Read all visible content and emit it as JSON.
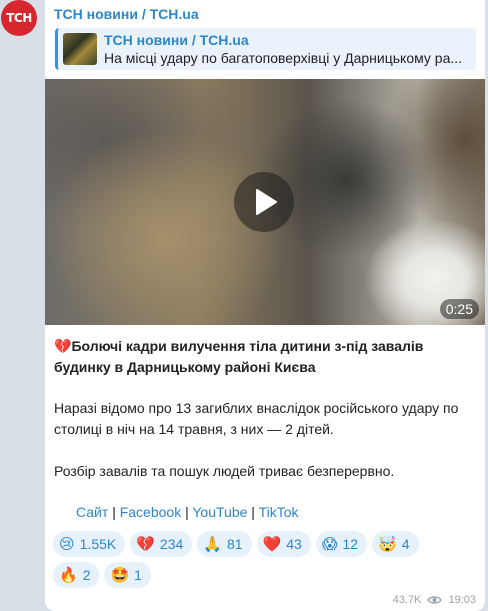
{
  "channel": {
    "avatar_text": "ТСН",
    "name": "ТСН новини / ТСН.ua"
  },
  "reply": {
    "title": "ТСН новини / ТСН.ua",
    "text": "На місці удару по багатоповерхівці у Дарницькому ра..."
  },
  "video": {
    "duration": "0:25"
  },
  "post": {
    "headline_emoji": "💔",
    "headline": "Болючі кадри вилучення тіла дитини з-під завалів будинку в Дарницькому районі Києва",
    "paragraph1": "Наразі відомо про 13 загиблих внаслідок російського удару по столиці в ніч на 14 травня, з них — 2 дітей.",
    "paragraph2": "Розбір завалів та пошук людей триває безперервно."
  },
  "links": {
    "sep": "|",
    "site": "Сайт",
    "facebook": "Facebook",
    "youtube": "YouTube",
    "tiktok": "TikTok"
  },
  "reactions": [
    {
      "emoji": "😢",
      "icon": "crying-face-icon",
      "count": "1.55K"
    },
    {
      "emoji": "💔",
      "icon": "broken-heart-icon",
      "count": "234"
    },
    {
      "emoji": "🙏",
      "icon": "praying-hands-icon",
      "count": "81"
    },
    {
      "emoji": "❤️",
      "icon": "red-heart-icon",
      "count": "43"
    },
    {
      "emoji": "😱",
      "icon": "screaming-face-icon",
      "count": "12"
    },
    {
      "emoji": "🤯",
      "icon": "exploding-head-icon",
      "count": "4"
    },
    {
      "emoji": "🔥",
      "icon": "fire-icon",
      "count": "2"
    },
    {
      "emoji": "🤩",
      "icon": "star-struck-icon",
      "count": "1"
    }
  ],
  "meta": {
    "views": "43.7K",
    "time": "19:03"
  },
  "colors": {
    "link": "#2d86c8",
    "brand_red": "#d8262e",
    "chat_bg": "#d9dfe6",
    "reaction_bg": "#e6f1fb"
  }
}
